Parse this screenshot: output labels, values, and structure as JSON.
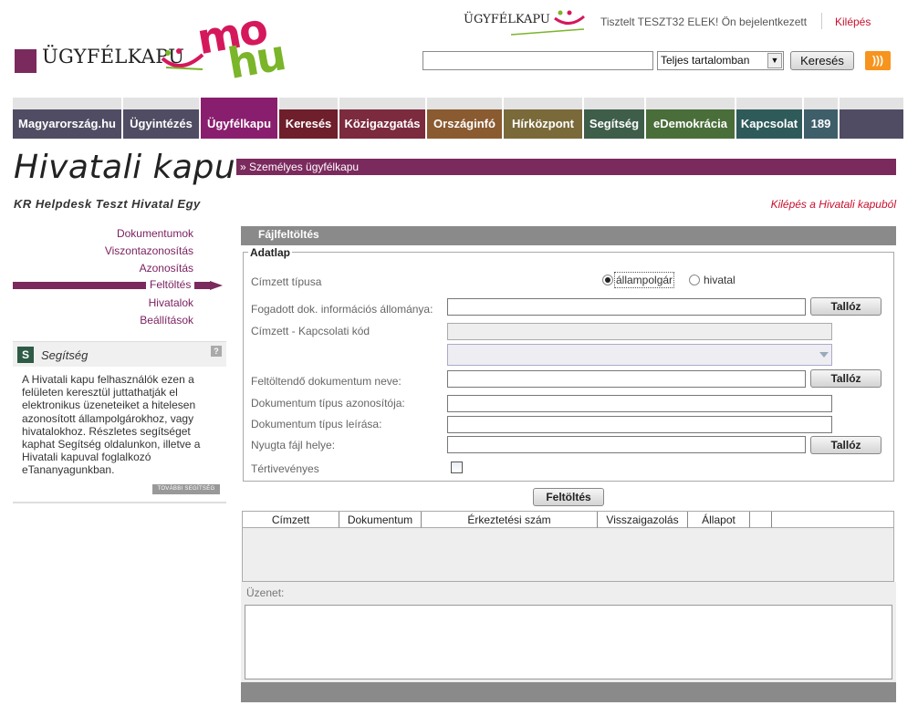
{
  "header": {
    "logo_text": "ÜGYFÉLKAPU",
    "logo_mo": "mo",
    "logo_hu": "hu",
    "small_logo_text": "ÜGYFÉLKAPU",
    "greeting": "Tisztelt TESZT32 ELEK! Ön bejelentkezett",
    "logout": "Kilépés",
    "search_placeholder": "",
    "search_scope": "Teljes tartalomban",
    "search_button": "Keresés",
    "colors": {
      "brand": "#7b2a5e",
      "mo": "#d5185c",
      "hu": "#7ab52a",
      "rss": "#f7941d"
    }
  },
  "nav": {
    "tabs": [
      {
        "label": "Magyarország.hu",
        "color": "#4f4c63"
      },
      {
        "label": "Ügyintézés",
        "color": "#4f4c63"
      },
      {
        "label": "Ügyfélkapu",
        "color": "#8a1e6e",
        "active": true
      },
      {
        "label": "Keresés",
        "color": "#6e1f2b"
      },
      {
        "label": "Közigazgatás",
        "color": "#7c2a3e"
      },
      {
        "label": "Országinfó",
        "color": "#8a5a30"
      },
      {
        "label": "Hírközpont",
        "color": "#7a6a3a"
      },
      {
        "label": "Segítség",
        "color": "#3e5e4a"
      },
      {
        "label": "eDemokrácia",
        "color": "#4a6e3a"
      },
      {
        "label": "Kapcsolat",
        "color": "#2f5a5a"
      },
      {
        "label": "189",
        "color": "#3e5e6a"
      },
      {
        "label": "",
        "color": "#4f4c63"
      }
    ]
  },
  "sidebar": {
    "title": "Hivatali kapu",
    "org": "KR Helpdesk Teszt Hivatal Egy",
    "menu": [
      "Dokumentumok",
      "Viszontazonosítás",
      "Azonosítás",
      "Feltöltés",
      "Hivatalok",
      "Beállítások"
    ],
    "active": "Feltöltés",
    "help": {
      "badge": "S",
      "title": "Segítség",
      "q": "?",
      "text": "A Hivatali kapu felhasználók ezen a felületen keresztül juttathatják el elektronikus üzeneteiket a hitelesen azonosított állampolgárokhoz, vagy hivatalokhoz. Részletes segítséget kaphat Segítség oldalunkon, illetve a Hivatali kapuval foglalkozó eTananyagunkban.",
      "more": "TOVÁBBI SEGÍTSÉG"
    }
  },
  "main": {
    "breadcrumb": "Személyes ügyfélkapu",
    "logout_hk": "Kilépés a Hivatali kapuból",
    "panel_title": "Fájlfeltöltés",
    "legend": "Adatlap",
    "fields": {
      "recipient_type": "Címzett típusa",
      "recipient_option_citizen": "állampolgár",
      "recipient_option_office": "hivatal",
      "received_doc_info": "Fogadott dok. információs állománya:",
      "recipient_code": "Címzett - Kapcsolati kód",
      "doc_name": "Feltöltendő dokumentum neve:",
      "doc_type_id": "Dokumentum típus azonosítója:",
      "doc_type_desc": "Dokumentum típus leírása:",
      "receipt_location": "Nyugta fájl helye:",
      "return_receipt": "Tértivevényes"
    },
    "browse": "Tallóz",
    "upload": "Feltöltés",
    "table_headers": [
      "Címzett",
      "Dokumentum",
      "Érkeztetési szám",
      "Visszaigazolás",
      "Állapot",
      ""
    ],
    "message_label": "Üzenet:"
  }
}
